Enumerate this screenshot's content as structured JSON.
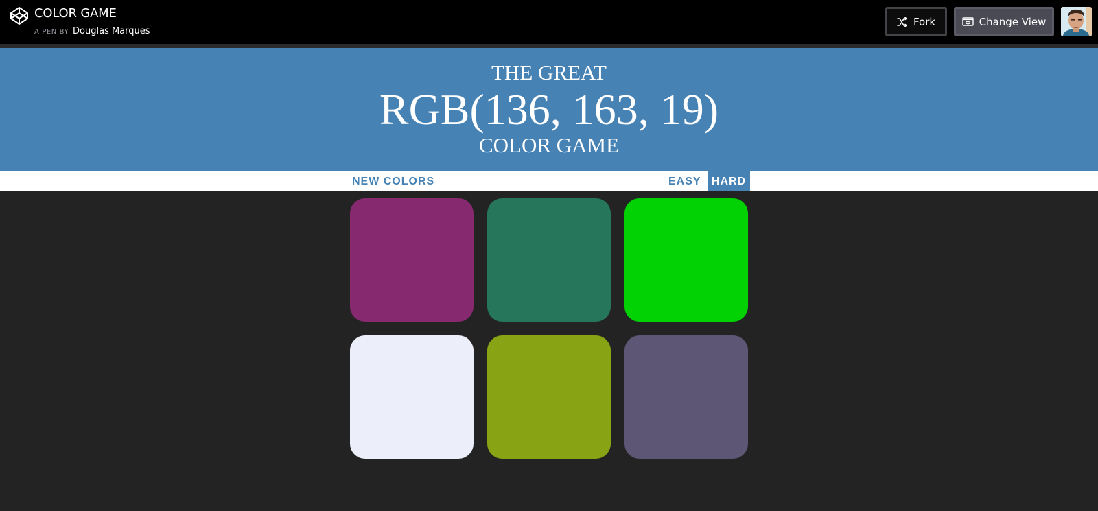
{
  "topbar": {
    "pen_title": "COLOR GAME",
    "by_label": "A PEN BY",
    "author": "Douglas Marques",
    "fork_label": "Fork",
    "change_view_label": "Change View"
  },
  "game": {
    "header_line1": "THE GREAT",
    "target_color": "RGB(136, 163, 19)",
    "header_line3": "COLOR GAME",
    "header_color": "#4682b4",
    "new_colors_label": "NEW COLORS",
    "easy_label": "EASY",
    "hard_label": "HARD",
    "active_mode": "HARD",
    "squares": [
      "#86296f",
      "#26765b",
      "#02d203",
      "#eceff9",
      "#88a313",
      "#5d5675"
    ]
  }
}
